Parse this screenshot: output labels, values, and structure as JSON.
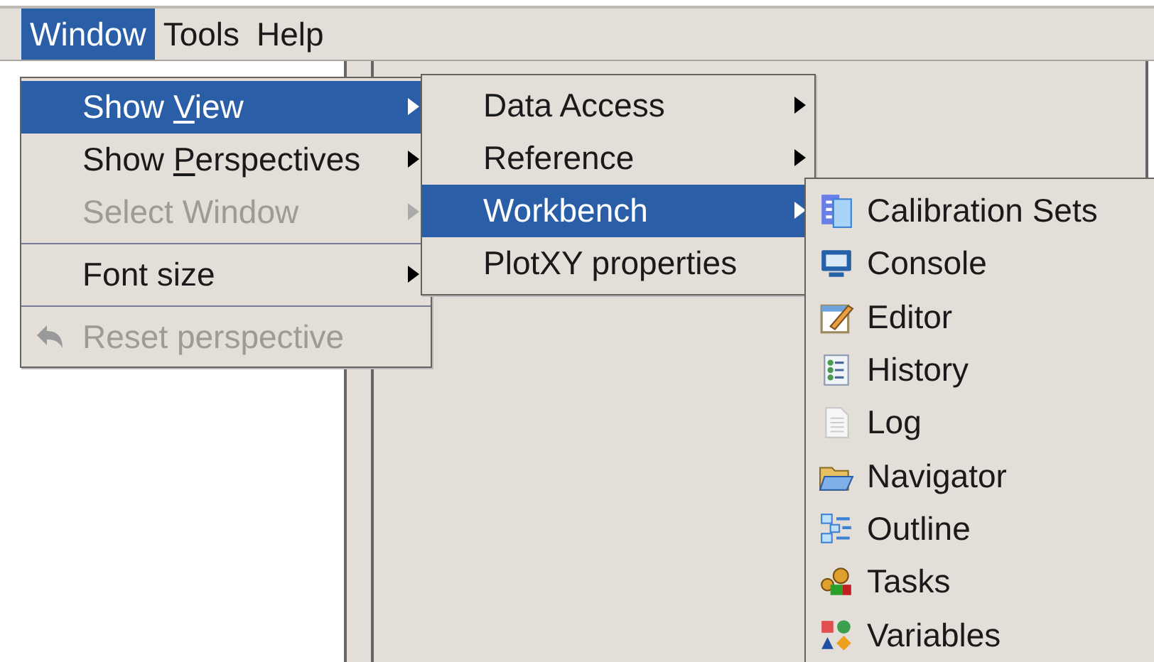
{
  "menu_bar": [
    {
      "label": "Window",
      "selected": true
    },
    {
      "label": "Tools",
      "selected": false
    },
    {
      "label": "Help",
      "selected": false
    }
  ],
  "window_menu": {
    "items": [
      {
        "kind": "submenu",
        "label_pre": "Show ",
        "mnemonic": "V",
        "label_post": "iew",
        "selected": true,
        "disabled": false
      },
      {
        "kind": "submenu",
        "label_pre": "Show ",
        "mnemonic": "P",
        "label_post": "erspectives",
        "selected": false,
        "disabled": false
      },
      {
        "kind": "submenu",
        "label_pre": "Select Window",
        "selected": false,
        "disabled": true
      },
      {
        "kind": "separator"
      },
      {
        "kind": "submenu",
        "label_pre": "Font size",
        "selected": false,
        "disabled": false
      },
      {
        "kind": "separator"
      },
      {
        "kind": "action",
        "label_pre": "Reset perspective",
        "selected": false,
        "disabled": true
      }
    ]
  },
  "show_view_menu": {
    "items": [
      {
        "label": "Data Access",
        "selected": false
      },
      {
        "label": "Reference",
        "selected": false
      },
      {
        "label": "Workbench",
        "selected": true
      },
      {
        "label": "PlotXY properties",
        "selected": false
      }
    ]
  },
  "workbench_menu": {
    "items": [
      {
        "label": "Calibration Sets"
      },
      {
        "label": "Console"
      },
      {
        "label": "Editor"
      },
      {
        "label": "History"
      },
      {
        "label": "Log"
      },
      {
        "label": "Navigator"
      },
      {
        "label": "Outline"
      },
      {
        "label": "Tasks"
      },
      {
        "label": "Variables"
      }
    ]
  }
}
